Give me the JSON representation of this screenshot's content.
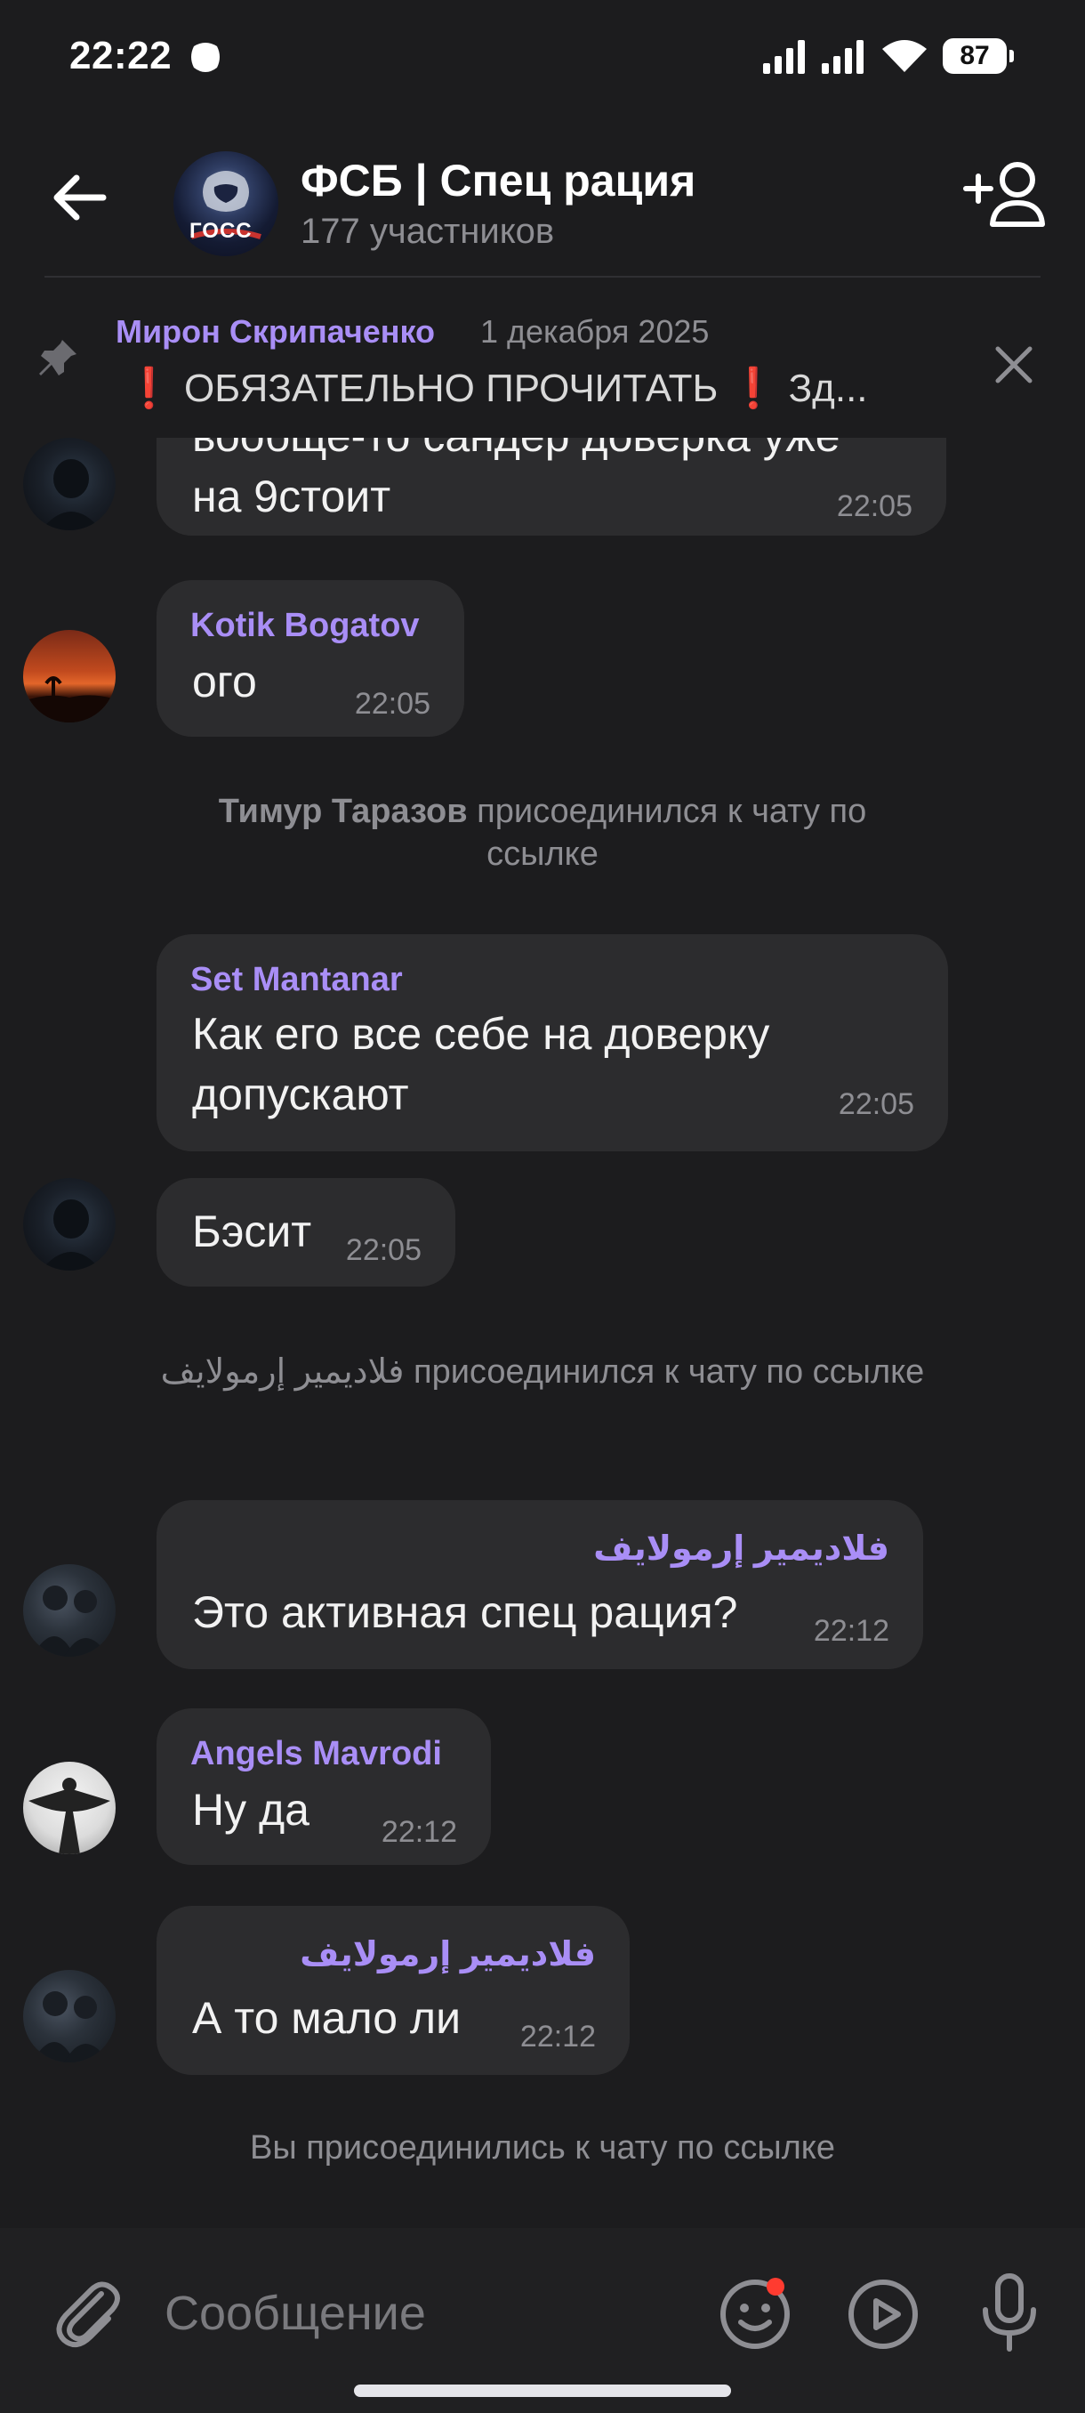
{
  "status_bar": {
    "time": "22:22",
    "battery": "87"
  },
  "header": {
    "avatar_text": "ГОСС",
    "title": "ФСБ | Спец рация",
    "subtitle": "177 участников"
  },
  "pinned": {
    "author": "Мирон Скрипаченко",
    "date": "1 декабря 2025",
    "text": "❗ ОБЯЗАТЕЛЬНО ПРОЧИТАТЬ ❗  Зд..."
  },
  "messages": [
    {
      "text_line1": "вообще-то сандер доверка уже",
      "text_line2": "на 9стоит",
      "time": "22:05"
    },
    {
      "sender": "Kotik Bogatov",
      "text": "ого",
      "time": "22:05"
    },
    {
      "service_bold": "Тимур Таразов",
      "service_text": " присоединился к чату по ссылке"
    },
    {
      "sender": "Set Mantanar",
      "text_line1": "Как его все себе на доверку",
      "text_line2": "допускают",
      "time": "22:05"
    },
    {
      "text": "Бэсит",
      "time": "22:05"
    },
    {
      "service_text": "فلاديمير إرمولايف присоединился к чату по ссылке"
    },
    {
      "sender": "فلاديمير إرمولايف",
      "text": "Это активная спец рация?",
      "time": "22:12"
    },
    {
      "sender": "Angels Mavrodi",
      "text": "Ну да",
      "time": "22:12"
    },
    {
      "sender": "فلاديمير إرمولايف",
      "text": "А то мало ли",
      "time": "22:12"
    },
    {
      "service_text": "Вы присоединились к чату по ссылке"
    }
  ],
  "input": {
    "placeholder": "Сообщение"
  },
  "colors": {
    "background": "#1c1c1e",
    "bubble": "#2c2c2e",
    "accent": "#a98ef6",
    "muted": "#8e8e93",
    "badge": "#ff3b30"
  },
  "icons": [
    "back-arrow-icon",
    "add-user-icon",
    "pin-icon",
    "close-icon",
    "attach-icon",
    "emoji-icon",
    "video-message-icon",
    "microphone-icon",
    "signal-icon",
    "wifi-icon",
    "battery-icon"
  ]
}
